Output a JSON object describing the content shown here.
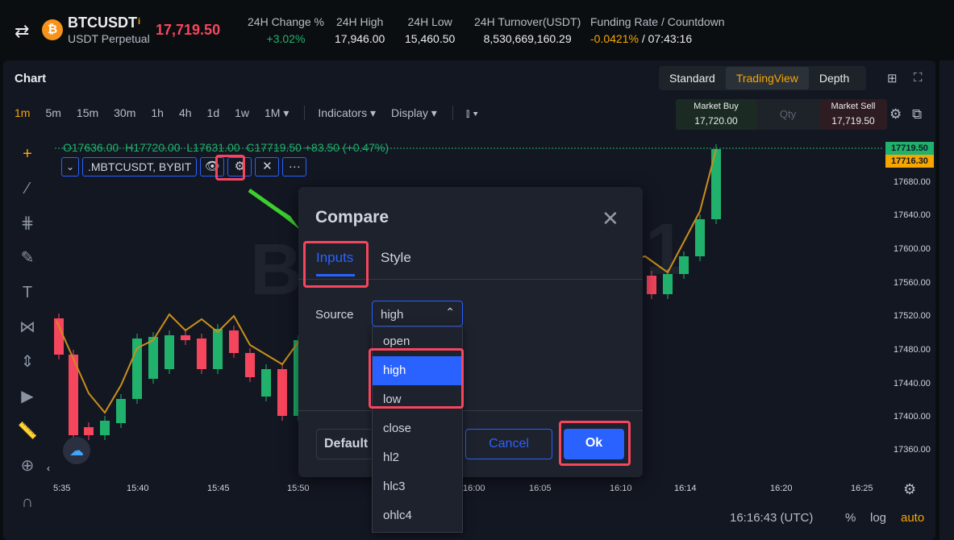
{
  "header": {
    "symbol": "BTCUSDT",
    "contract": "USDT Perpetual",
    "coin_glyph": "₿",
    "info_glyph": "i",
    "last_price": "17,719.50",
    "stats": [
      {
        "label": "24H Change %",
        "value": "+3.02%"
      },
      {
        "label": "24H High",
        "value": "17,946.00"
      },
      {
        "label": "24H Low",
        "value": "15,460.50"
      },
      {
        "label": "24H Turnover(USDT)",
        "value": "8,530,669,160.29"
      }
    ],
    "funding": {
      "label": "Funding Rate / Countdown",
      "rate": "-0.0421%",
      "countdown": "/ 07:43:16"
    }
  },
  "chart_panel": {
    "title": "Chart",
    "views": [
      "Standard",
      "TradingView",
      "Depth"
    ],
    "active_view": "TradingView"
  },
  "toolbar": {
    "timeframes": [
      "1m",
      "5m",
      "15m",
      "30m",
      "1h",
      "4h",
      "1d",
      "1w"
    ],
    "active_tf": "1m",
    "more_tf": "1M ▾",
    "indicators": "Indicators ▾",
    "display": "Display ▾"
  },
  "market": {
    "buy_label": "Market Buy",
    "buy_price": "17,720.00",
    "qty_placeholder": "Qty",
    "sell_label": "Market Sell",
    "sell_price": "17,719.50"
  },
  "ohlc": {
    "open": "O17636.00",
    "high": "H17720.00",
    "low": "L17631.00",
    "close": "C17719.50",
    "change": "+83.50 (+0.47%)"
  },
  "legend": {
    "symbol": ".MBTCUSDT, BYBIT"
  },
  "price_axis": {
    "labels": [
      "17680.00",
      "17640.00",
      "17600.00",
      "17560.00",
      "17520.00",
      "17480.00",
      "17440.00",
      "17400.00",
      "17360.00"
    ],
    "last": "17719.50",
    "compare": "17716.30"
  },
  "time_axis": {
    "labels": [
      "5:35",
      "15:40",
      "15:45",
      "15:50",
      "16:00",
      "16:05",
      "16:10",
      "16:14",
      "16:20",
      "16:25"
    ]
  },
  "bottom": {
    "clock": "16:16:43 (UTC)",
    "percent": "%",
    "log": "log",
    "auto": "auto"
  },
  "watermark": "B",
  "watermark2": "1",
  "chart_data": {
    "type": "candlestick",
    "colors": {
      "up": "#20b26c",
      "down": "#f6465d",
      "compare": "#c98f1a"
    }
  },
  "dialog": {
    "title": "Compare",
    "tabs": [
      "Inputs",
      "Style"
    ],
    "active_tab": "Inputs",
    "source_label": "Source",
    "source_value": "high",
    "default_label": "Default",
    "cancel": "Cancel",
    "ok": "Ok",
    "options": [
      "open",
      "high",
      "low",
      "close",
      "hl2",
      "hlc3",
      "ohlc4"
    ],
    "selected": "high"
  }
}
